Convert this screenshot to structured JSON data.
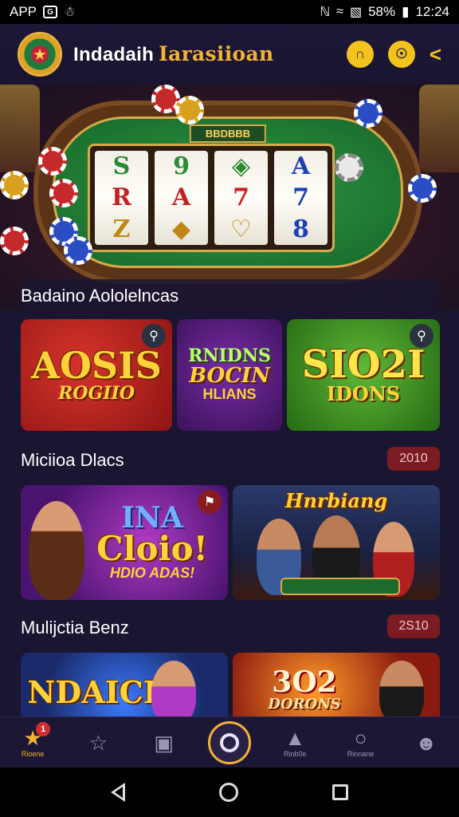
{
  "status_bar": {
    "app_label": "APP",
    "battery": "58%",
    "time": "12:24"
  },
  "header": {
    "brand_part1": "Indadaih",
    "brand_part2": "Iarasiioan"
  },
  "hero": {
    "table_label": "BBDBBB"
  },
  "section1": {
    "title": "Badaino  Aololelncas",
    "cards": [
      {
        "line1": "AOSIS",
        "line2": "ROGIIO"
      },
      {
        "line1": "RNIDNS",
        "line2": "BOCIN",
        "line3": "HLIANS"
      },
      {
        "line1": "SIO2I",
        "line2": "IDONS"
      }
    ]
  },
  "section2": {
    "title": "Miciioa Dlacs",
    "badge": "2010",
    "cards": [
      {
        "line1": "INA",
        "line2": "Cloio!",
        "line3": "HDIO ADAS!"
      },
      {
        "line1": "Hnrbiang",
        "line2": ""
      }
    ]
  },
  "section3": {
    "title": "Mulijctia Benz",
    "badge": "2S10",
    "cards": [
      {
        "line1": "NDAICI"
      },
      {
        "line1": "3O2",
        "line2": "DORONS"
      }
    ]
  },
  "bottom_nav": {
    "items": [
      {
        "label": "Rioene",
        "badge": "1"
      },
      {
        "label": ""
      },
      {
        "label": ""
      },
      {
        "label": ""
      },
      {
        "label": "Rinb0e"
      },
      {
        "label": "Rinnane"
      },
      {
        "label": ""
      }
    ]
  },
  "colors": {
    "background": "#1a1530",
    "accent_gold": "#f2b233",
    "badge_red": "#7a1c22"
  }
}
